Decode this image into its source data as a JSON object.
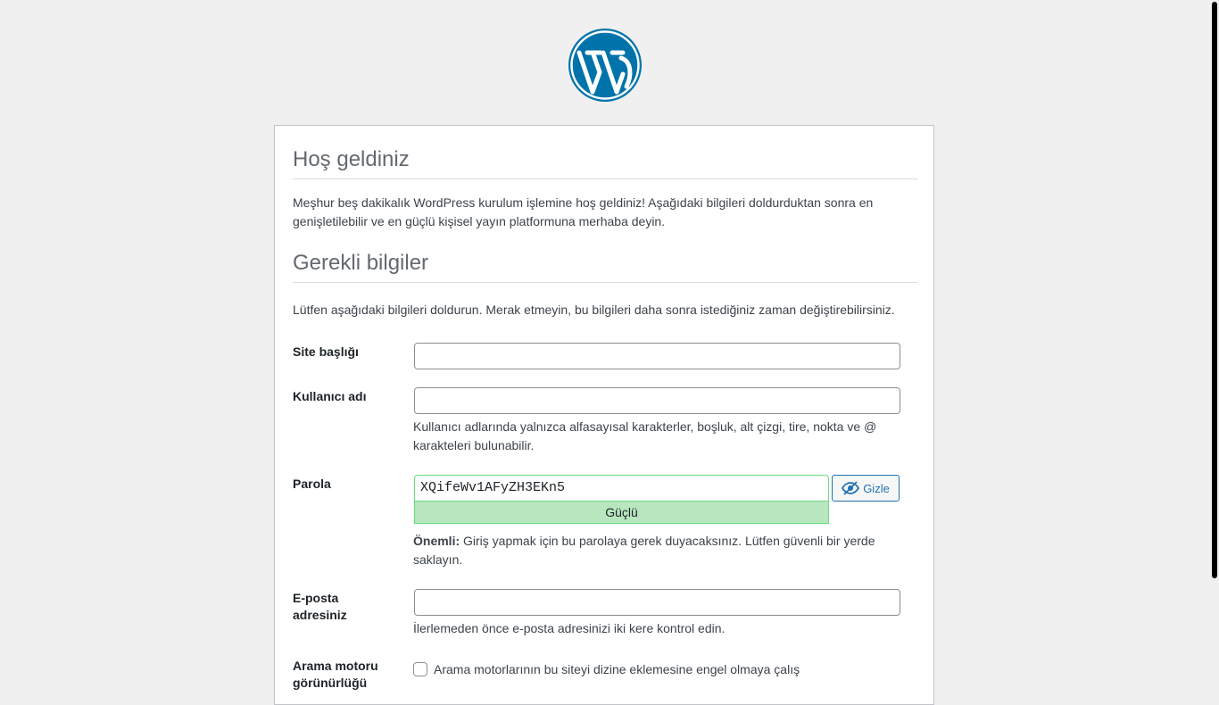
{
  "branding": {
    "logo_icon": "wordpress-logo-icon",
    "logo_color": "#0073aa"
  },
  "welcome": {
    "title": "Hoş geldiniz",
    "text": "Meşhur beş dakikalık WordPress kurulum işlemine hoş geldiniz! Aşağıdaki bilgileri doldurduktan sonra en genişletilebilir ve en güçlü kişisel yayın platformuna merhaba deyin."
  },
  "required": {
    "title": "Gerekli bilgiler",
    "text": "Lütfen aşağıdaki bilgileri doldurun. Merak etmeyin, bu bilgileri daha sonra istediğiniz zaman değiştirebilirsiniz."
  },
  "form": {
    "site_title": {
      "label": "Site başlığı",
      "value": ""
    },
    "username": {
      "label": "Kullanıcı adı",
      "value": "",
      "help": "Kullanıcı adlarında yalnızca alfasayısal karakterler, boşluk, alt çizgi, tire, nokta ve @ karakteleri bulunabilir."
    },
    "password": {
      "label": "Parola",
      "value": "XQifeWv1AFyZH3EKn5",
      "strength": "Güçlü",
      "hide_label": "Gizle",
      "note_bold": "Önemli:",
      "note": " Giriş yapmak için bu parolaya gerek duyacaksınız. Lütfen güvenli bir yerde saklayın."
    },
    "email": {
      "label": "E-posta adresiniz",
      "value": "",
      "help": "İlerlemeden önce e-posta adresinizi iki kere kontrol edin."
    },
    "search_engine": {
      "label": "Arama motoru görünürlüğü",
      "checkbox_label": "Arama motorlarının bu siteyi dizine eklemesine engel olmaya çalış",
      "checked": false
    }
  }
}
